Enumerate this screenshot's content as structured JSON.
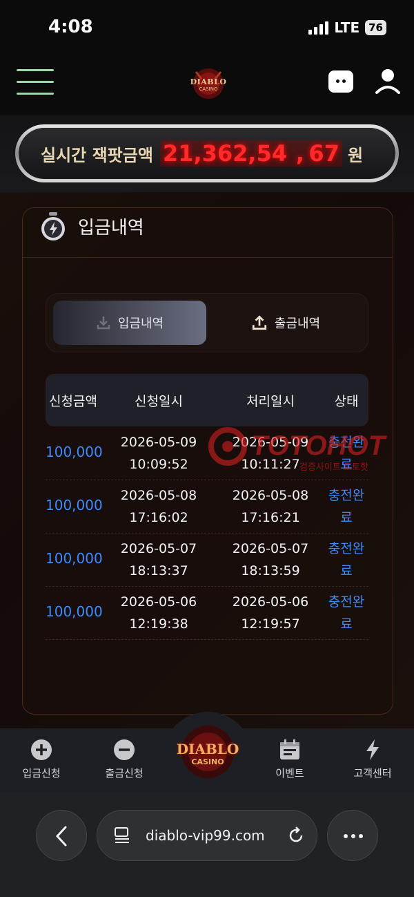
{
  "status_bar": {
    "time": "4:08",
    "network": "LTE",
    "battery": "76"
  },
  "header": {
    "logo_text": "DIABLO",
    "logo_sub": "CASINO"
  },
  "jackpot": {
    "label": "실시간 잭팟금액",
    "amount": "21,362,54  , 67",
    "unit": "원"
  },
  "panel": {
    "title": "입금내역"
  },
  "tabs": [
    {
      "label": "입금내역",
      "active": true,
      "icon": "download-icon"
    },
    {
      "label": "출금내역",
      "active": false,
      "icon": "upload-icon"
    }
  ],
  "table": {
    "headers": [
      "신청금액",
      "신청일시",
      "처리일시",
      "상태"
    ],
    "rows": [
      {
        "amount": "100,000",
        "req_date": "2026-05-09",
        "req_time": "10:09:52",
        "proc_date": "2026-05-09",
        "proc_time": "10:11:27",
        "status_1": "충전완",
        "status_2": "료"
      },
      {
        "amount": "100,000",
        "req_date": "2026-05-08",
        "req_time": "17:16:02",
        "proc_date": "2026-05-08",
        "proc_time": "17:16:21",
        "status_1": "충전완",
        "status_2": "료"
      },
      {
        "amount": "100,000",
        "req_date": "2026-05-07",
        "req_time": "18:13:37",
        "proc_date": "2026-05-07",
        "proc_time": "18:13:59",
        "status_1": "충전완",
        "status_2": "료"
      },
      {
        "amount": "100,000",
        "req_date": "2026-05-06",
        "req_time": "12:19:38",
        "proc_date": "2026-05-06",
        "proc_time": "12:19:57",
        "status_1": "충전완",
        "status_2": "료"
      }
    ]
  },
  "watermark": {
    "brand": "TOTOHOT",
    "sub": "검증사이트 토토핫"
  },
  "bottom_nav": [
    {
      "label": "입금신청",
      "icon": "plus-circle-icon"
    },
    {
      "label": "출금신청",
      "icon": "minus-circle-icon"
    },
    {
      "label": "이벤트",
      "icon": "calendar-icon"
    },
    {
      "label": "고객센터",
      "icon": "lightning-icon"
    }
  ],
  "center_logo": {
    "text": "DIABLO",
    "sub": "CASINO"
  },
  "browser": {
    "url": "diablo-vip99.com"
  },
  "colors": {
    "accent_blue": "#3d8bff",
    "jackpot_red": "#ff2a2a",
    "hamburger_green": "#9fd9a8"
  }
}
